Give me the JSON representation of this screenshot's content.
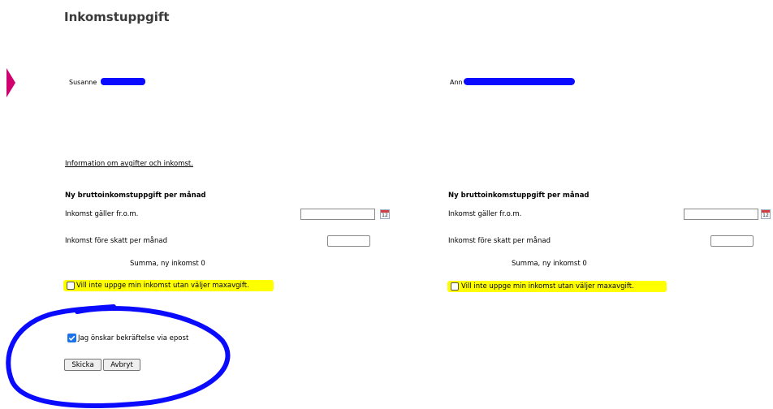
{
  "page": {
    "title": "Inkomstuppgift"
  },
  "persons": [
    {
      "name": "Susanne"
    },
    {
      "name": "Ann"
    }
  ],
  "info_link": "Information om avgifter och inkomst.",
  "sections": [
    {
      "heading": "Ny bruttoinkomstuppgift per månad",
      "date_label": "Inkomst gäller fr.o.m.",
      "date_value": "",
      "income_label": "Inkomst före skatt per månad",
      "income_value": "",
      "summa": "Summa, ny inkomst 0",
      "maxavgift_label": "Vill inte uppge min inkomst utan väljer maxavgift.",
      "maxavgift_checked": false
    },
    {
      "heading": "Ny bruttoinkomstuppgift per månad",
      "date_label": "Inkomst gäller fr.o.m.",
      "date_value": "",
      "income_label": "Inkomst före skatt per månad",
      "income_value": "",
      "summa": "Summa, ny inkomst 0",
      "maxavgift_label": "Vill inte uppge min inkomst utan väljer maxavgift.",
      "maxavgift_checked": false
    }
  ],
  "calendar_icon_text": "12",
  "confirm_email": {
    "label": "Jag önskar bekräftelse via epost",
    "checked": true
  },
  "buttons": {
    "submit": "Skicka",
    "cancel": "Avbryt"
  },
  "colors": {
    "accent_arrow": "#d0006f",
    "highlight": "#ffff00",
    "annotation": "#0a0aff",
    "checkbox": "#1a73e8"
  }
}
